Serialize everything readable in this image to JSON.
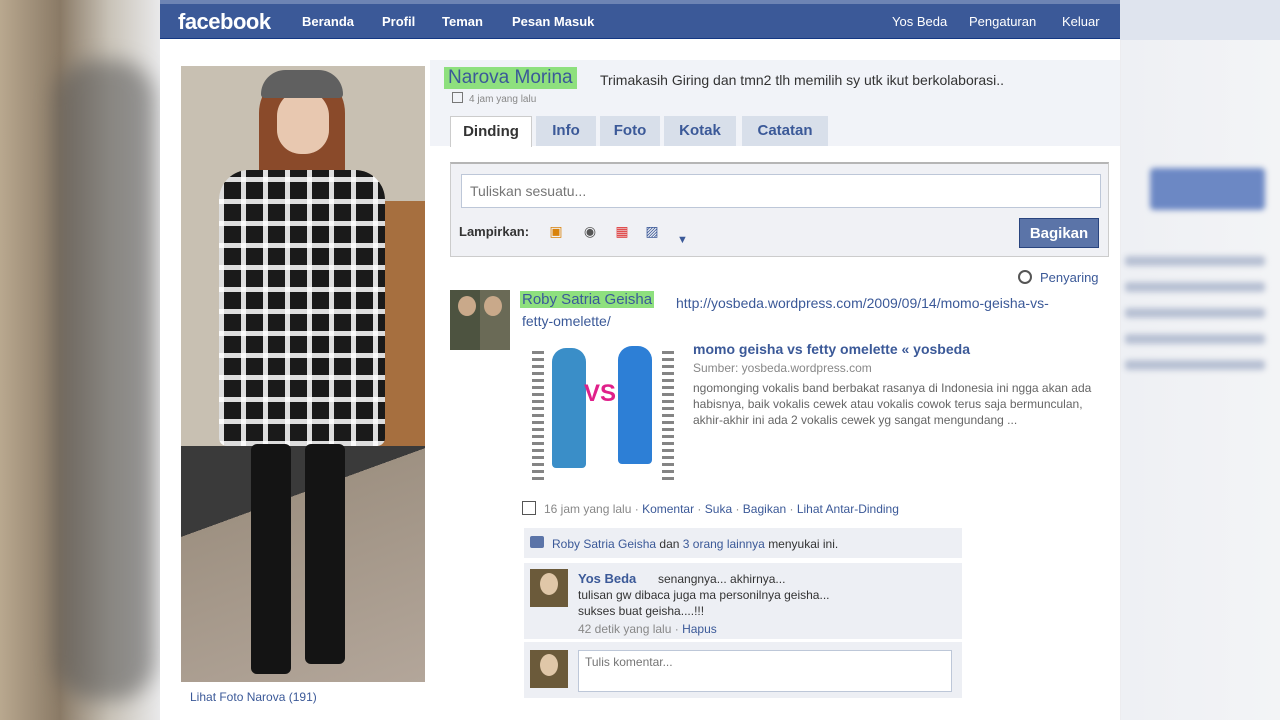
{
  "colors": {
    "brand": "#3b5998",
    "highlight": "#8ee07e",
    "button": "#5b74a8"
  },
  "topbar": {
    "logo": "facebook",
    "nav": [
      "Beranda",
      "Profil",
      "Teman",
      "Pesan Masuk"
    ],
    "right": [
      "Yos Beda",
      "Pengaturan",
      "Keluar"
    ]
  },
  "profile": {
    "photo_link": "Lihat Foto Narova (191)",
    "name": "Narova Morina",
    "status": "Trimakasih Giring dan tmn2 tlh memilih sy utk ikut berkolaborasi..",
    "status_time": "4 jam yang lalu",
    "tabs": [
      "Dinding",
      "Info",
      "Foto",
      "Kotak",
      "Catatan"
    ]
  },
  "composer": {
    "placeholder": "Tuliskan sesuatu...",
    "attach_label": "Lampirkan:",
    "attach_icons": [
      "photo-icon",
      "video-icon",
      "event-icon",
      "link-icon"
    ],
    "share_label": "Bagikan"
  },
  "filter_label": "Penyaring",
  "post": {
    "author": "Roby Satria Geisha",
    "url_line1": "http://yosbeda.wordpress.com/2009/09/14/momo-geisha-vs-",
    "url_line2": "fetty-omelette/",
    "thumb_text": "VS",
    "link_title": "momo geisha vs fetty omelette « yosbeda",
    "link_source": "Sumber: yosbeda.wordpress.com",
    "link_desc": "ngomonging vokalis band berbakat rasanya di Indonesia ini ngga akan ada habisnya, baik vokalis cewek atau vokalis cowok terus saja bermunculan, akhir-akhir ini ada 2 vokalis cewek yg sangat mengundang ...",
    "time": "16 jam yang lalu",
    "actions": [
      "Komentar",
      "Suka",
      "Bagikan",
      "Lihat Antar-Dinding"
    ],
    "likes": {
      "liker": "Roby Satria Geisha",
      "and": "dan",
      "others": "3 orang lainnya",
      "suffix": "menyukai ini."
    },
    "comment": {
      "author": "Yos Beda",
      "line1": "senangnya... akhirnya...",
      "line2": "tulisan gw dibaca juga ma personilnya geisha...",
      "line3": "sukses buat geisha....!!!",
      "time": "42 detik yang lalu",
      "delete": "Hapus"
    },
    "reply_placeholder": "Tulis komentar..."
  }
}
